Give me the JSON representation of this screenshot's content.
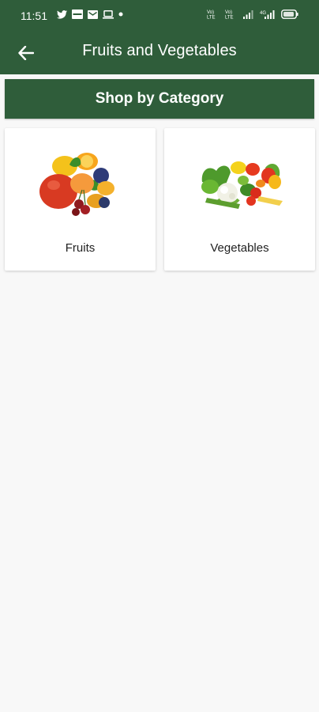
{
  "status_bar": {
    "time": "11:51",
    "notification_icons": [
      "twitter-icon",
      "message-icon",
      "mail-icon",
      "laptop-icon",
      "dot-icon"
    ],
    "system_icons": [
      "wifi-calling-icon",
      "volte-icon",
      "signal-icon",
      "signal-icon",
      "battery-icon"
    ]
  },
  "app_bar": {
    "title": "Fruits and Vegetables",
    "back_icon": "arrow-left-icon"
  },
  "section": {
    "header": "Shop by Category"
  },
  "categories": [
    {
      "label": "Fruits",
      "image": "fruits-image"
    },
    {
      "label": "Vegetables",
      "image": "vegetables-image"
    }
  ],
  "colors": {
    "primary": "#2f5d3a",
    "background": "#f8f8f8",
    "card": "#ffffff"
  }
}
